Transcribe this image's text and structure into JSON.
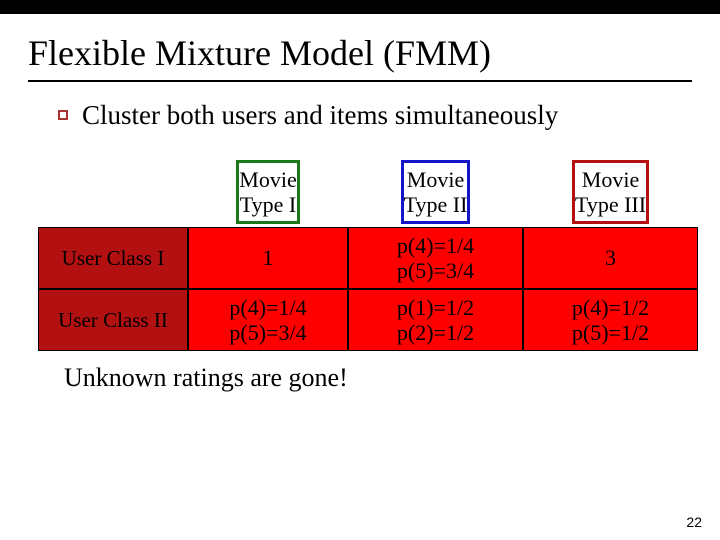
{
  "title": "Flexible Mixture Model (FMM)",
  "subtitle": "Cluster both users and items simultaneously",
  "headers": {
    "col1": "Movie Type I",
    "col2": "Movie Type II",
    "col3": "Movie Type III"
  },
  "rows": [
    {
      "label": "User Class I",
      "cells": [
        "1",
        "p(4)=1/4\np(5)=3/4",
        "3"
      ]
    },
    {
      "label": "User Class II",
      "cells": [
        "p(4)=1/4\np(5)=3/4",
        "p(1)=1/2\np(2)=1/2",
        "p(4)=1/2\np(5)=1/2"
      ]
    }
  ],
  "footnote": "Unknown ratings are gone!",
  "page_number": "22"
}
